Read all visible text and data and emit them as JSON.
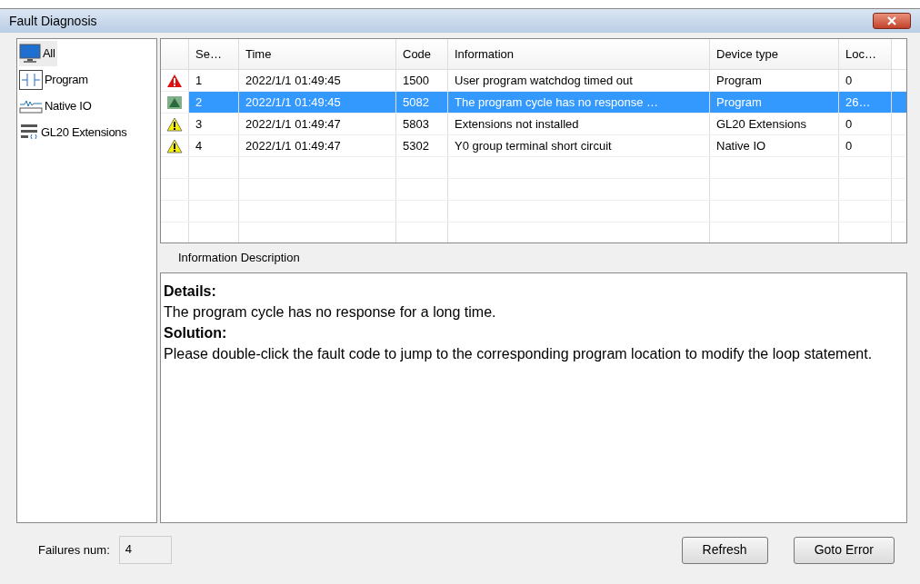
{
  "window": {
    "title": "Fault Diagnosis"
  },
  "sidebar": {
    "items": [
      {
        "label": "All",
        "kind": "monitor",
        "selected": true
      },
      {
        "label": "Program",
        "kind": "contact",
        "selected": false
      },
      {
        "label": "Native IO",
        "kind": "io",
        "selected": false
      },
      {
        "label": "GL20 Extensions",
        "kind": "extension",
        "selected": false
      }
    ]
  },
  "table": {
    "columns": [
      "",
      "Se…",
      "Time",
      "Code",
      "Information",
      "Device type",
      "Loc…"
    ],
    "rows": [
      {
        "kind": "error",
        "selected": false,
        "cells": [
          "",
          "1",
          "2022/1/1 01:49:45",
          "1500",
          "User program watchdog timed out",
          "Program",
          "0"
        ]
      },
      {
        "kind": "info",
        "selected": true,
        "cells": [
          "",
          "2",
          "2022/1/1 01:49:45",
          "5082",
          "The program cycle has no response …",
          "Program",
          "26…"
        ]
      },
      {
        "kind": "warning",
        "selected": false,
        "cells": [
          "",
          "3",
          "2022/1/1 01:49:47",
          "5803",
          "Extensions not installed",
          "GL20 Extensions",
          "0"
        ]
      },
      {
        "kind": "warning",
        "selected": false,
        "cells": [
          "",
          "4",
          "2022/1/1 01:49:47",
          "5302",
          "Y0 group terminal short circuit",
          "Native IO",
          "0"
        ]
      }
    ]
  },
  "description": {
    "tab": "Information Description",
    "details_heading": "Details:",
    "details": "The program cycle has no response for a long time.",
    "solution_heading": "Solution:",
    "solution": "Please double-click the fault code to jump to the corresponding program location to modify the loop statement."
  },
  "footer": {
    "failures_label": "Failures num:",
    "failures_value": "4",
    "buttons": [
      "Refresh",
      "Goto Error"
    ]
  }
}
